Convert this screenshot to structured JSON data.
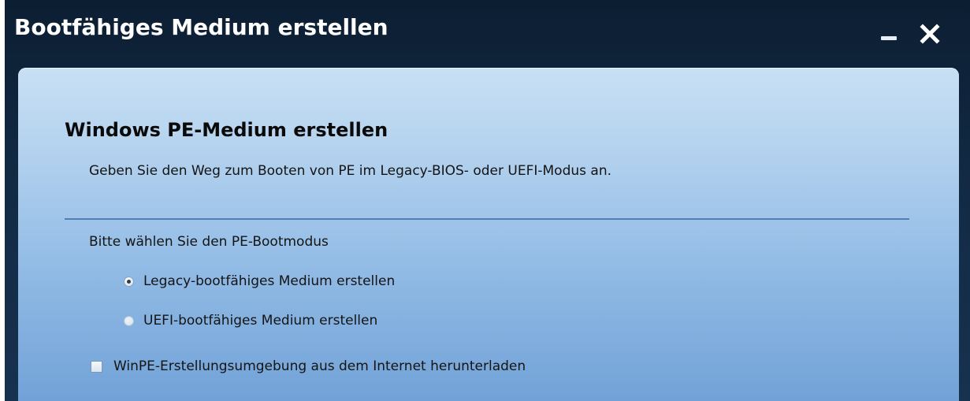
{
  "window": {
    "title": "Bootfähiges Medium erstellen",
    "minimize_icon": "minimize-icon",
    "close_icon": "close-icon"
  },
  "main": {
    "heading": "Windows PE-Medium erstellen",
    "description": "Geben Sie den Weg zum Booten von PE im Legacy-BIOS- oder UEFI-Modus an.",
    "mode_label": "Bitte wählen Sie den PE-Bootmodus",
    "options": [
      {
        "label": "Legacy-bootfähiges Medium erstellen",
        "selected": true
      },
      {
        "label": "UEFI-bootfähiges Medium erstellen",
        "selected": false
      }
    ],
    "download_checkbox": {
      "label": "WinPE-Erstellungsumgebung aus dem Internet herunterladen",
      "checked": false
    }
  },
  "colors": {
    "titlebar": "#0c1e32",
    "panel_top": "#c8e0f4",
    "panel_bottom": "#6e9fd6",
    "divider": "#4f7fb4"
  }
}
